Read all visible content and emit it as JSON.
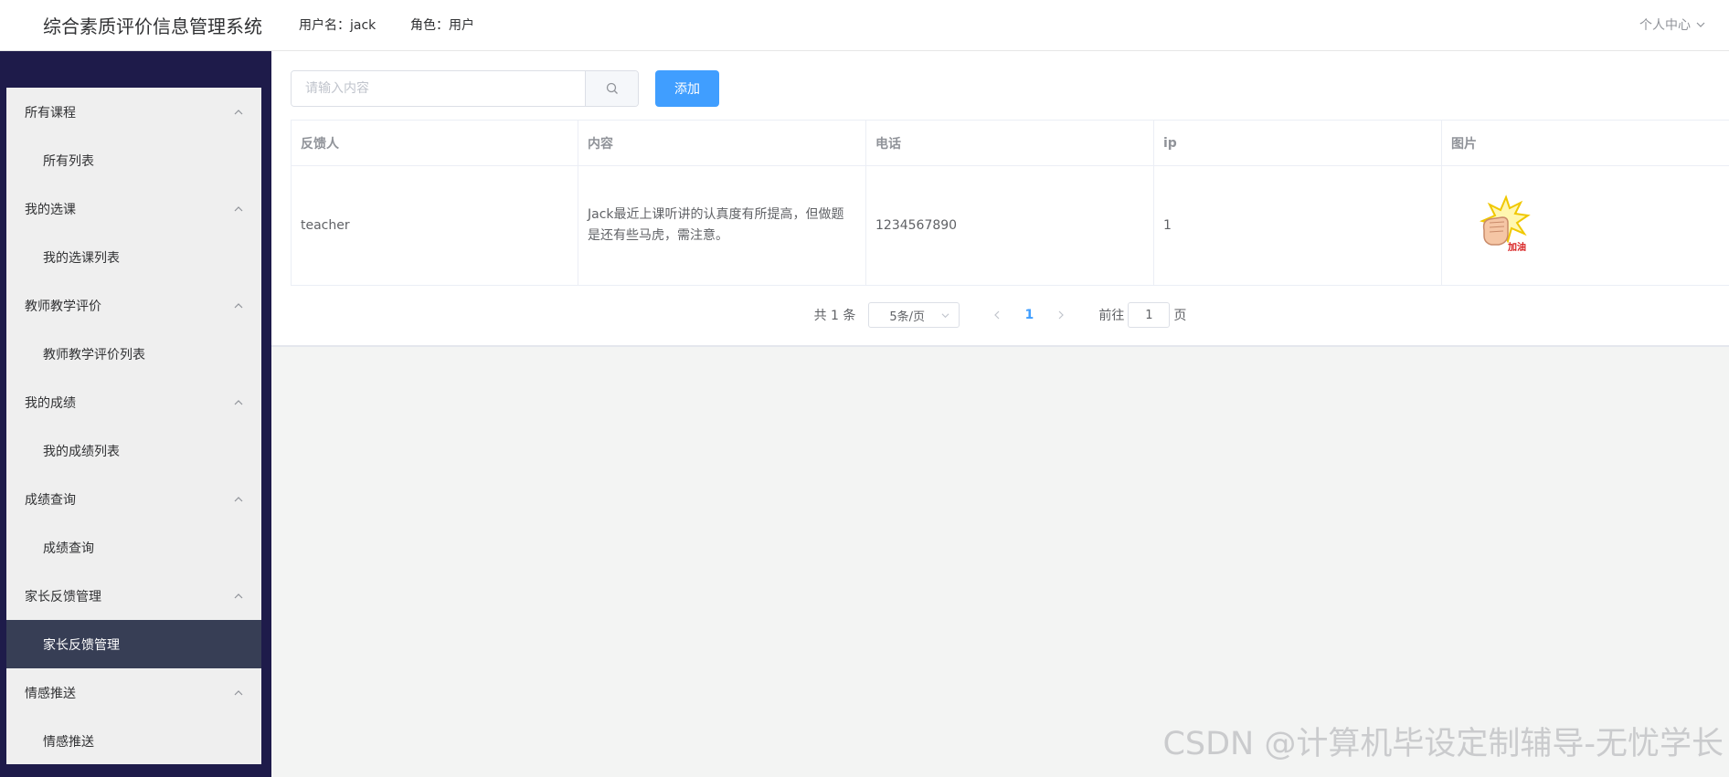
{
  "header": {
    "app_title": "综合素质评价信息管理系统",
    "username": "用户名：jack",
    "role": "角色：用户",
    "personal_center": "个人中心"
  },
  "sidebar": {
    "groups": [
      {
        "title": "所有课程",
        "item": "所有列表"
      },
      {
        "title": "我的选课",
        "item": "我的选课列表"
      },
      {
        "title": "教师教学评价",
        "item": "教师教学评价列表"
      },
      {
        "title": "我的成绩",
        "item": "我的成绩列表"
      },
      {
        "title": "成绩查询",
        "item": "成绩查询"
      },
      {
        "title": "家长反馈管理",
        "item": "家长反馈管理"
      },
      {
        "title": "情感推送",
        "item": "情感推送"
      }
    ],
    "active_item": "家长反馈管理"
  },
  "toolbar": {
    "search_placeholder": "请输入内容",
    "add_label": "添加"
  },
  "table": {
    "columns": [
      "反馈人",
      "内容",
      "电话",
      "ip",
      "图片"
    ],
    "rows": [
      {
        "feedbacker": "teacher",
        "content": "Jack最近上课听讲的认真度有所提高，但做题是还有些马虎，需注意。",
        "phone": "1234567890",
        "ip": "1",
        "image_text": "加油"
      }
    ]
  },
  "pagination": {
    "total": "共 1 条",
    "page_size": "5条/页",
    "current_page": "1",
    "goto_prefix": "前往",
    "goto_value": "1",
    "goto_suffix": "页"
  },
  "watermark": "CSDN @计算机毕设定制辅导-无忧学长",
  "colors": {
    "primary": "#409eff",
    "sidebar_bg": "#1e1b4a",
    "menu_active_bg": "#373e55"
  }
}
